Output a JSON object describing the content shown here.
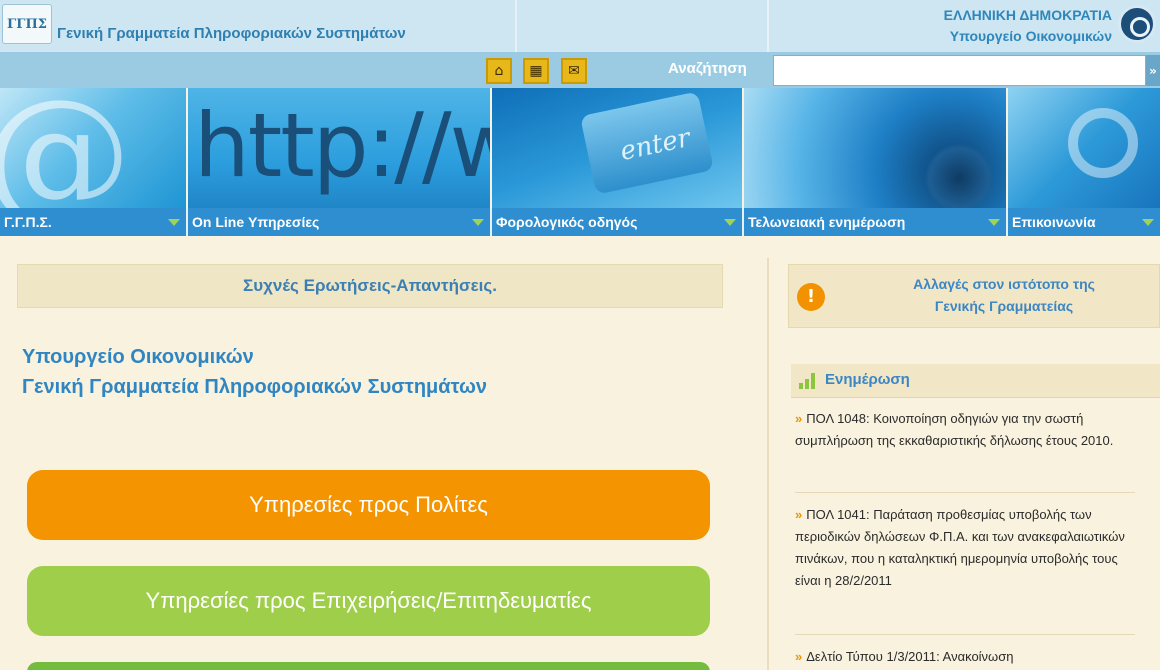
{
  "header": {
    "logo_text": "ΓΓΠΣ",
    "title": "Γενική Γραμματεία Πληροφοριακών Συστημάτων",
    "republic_line1": "ΕΛΛΗΝΙΚΗ ΔΗΜΟΚΡΑΤΙΑ",
    "republic_line2": "Υπουργείο Οικονομικών"
  },
  "toolbar": {
    "icons": [
      "home-icon",
      "sitemap-icon",
      "mail-icon"
    ],
    "search_label": "Αναζήτηση",
    "search_value": "",
    "search_go": "»"
  },
  "nav": {
    "items": [
      {
        "label": "Γ.Γ.Π.Σ."
      },
      {
        "label": "On Line Υπηρεσίες"
      },
      {
        "label": "Φορολογικός οδηγός"
      },
      {
        "label": "Τελωνειακή ενημέρωση"
      },
      {
        "label": "Επικοινωνία"
      }
    ]
  },
  "main": {
    "faq_label": "Συχνές Ερωτήσεις-Απαντήσεις.",
    "org_line1": "Υπουργείο Οικονομικών",
    "org_line2": "Γενική Γραμματεία Πληροφοριακών Συστημάτων",
    "btn_citizens": "Υπηρεσίες προς Πολίτες",
    "btn_business": "Υπηρεσίες προς Επιχειρήσεις/Επιτηδευματίες"
  },
  "side": {
    "notice_icon": "!",
    "notice_line1": "Αλλαγές στον ιστότοπο της",
    "notice_line2": "Γενικής Γραμματείας",
    "news_title": "Ενημέρωση",
    "news": [
      {
        "text": "ΠΟΛ 1048: Κοινοποίηση οδηγιών για την σωστή συμπλήρωση της εκκαθαριστικής δήλωσης έτους 2010."
      },
      {
        "text": "ΠΟΛ 1041: Παράταση προθεσμίας υποβολής των περιοδικών δηλώσεων Φ.Π.Α. και των ανακεφαλαιωτικών πινάκων, που η καταληκτική ημερομηνία υποβολής τους είναι η 28/2/2011"
      },
      {
        "text": "Δελτίο Τύπου 1/3/2011: Ανακοίνωση"
      }
    ],
    "chev": "»"
  },
  "banner": {
    "http_text": "http://www",
    "enter_text": "enter",
    "at_text": "@"
  },
  "colors": {
    "orange": "#f39400",
    "green": "#9fcf4a",
    "nav_blue": "#2e8ed0",
    "text_blue": "#2f86c2"
  }
}
